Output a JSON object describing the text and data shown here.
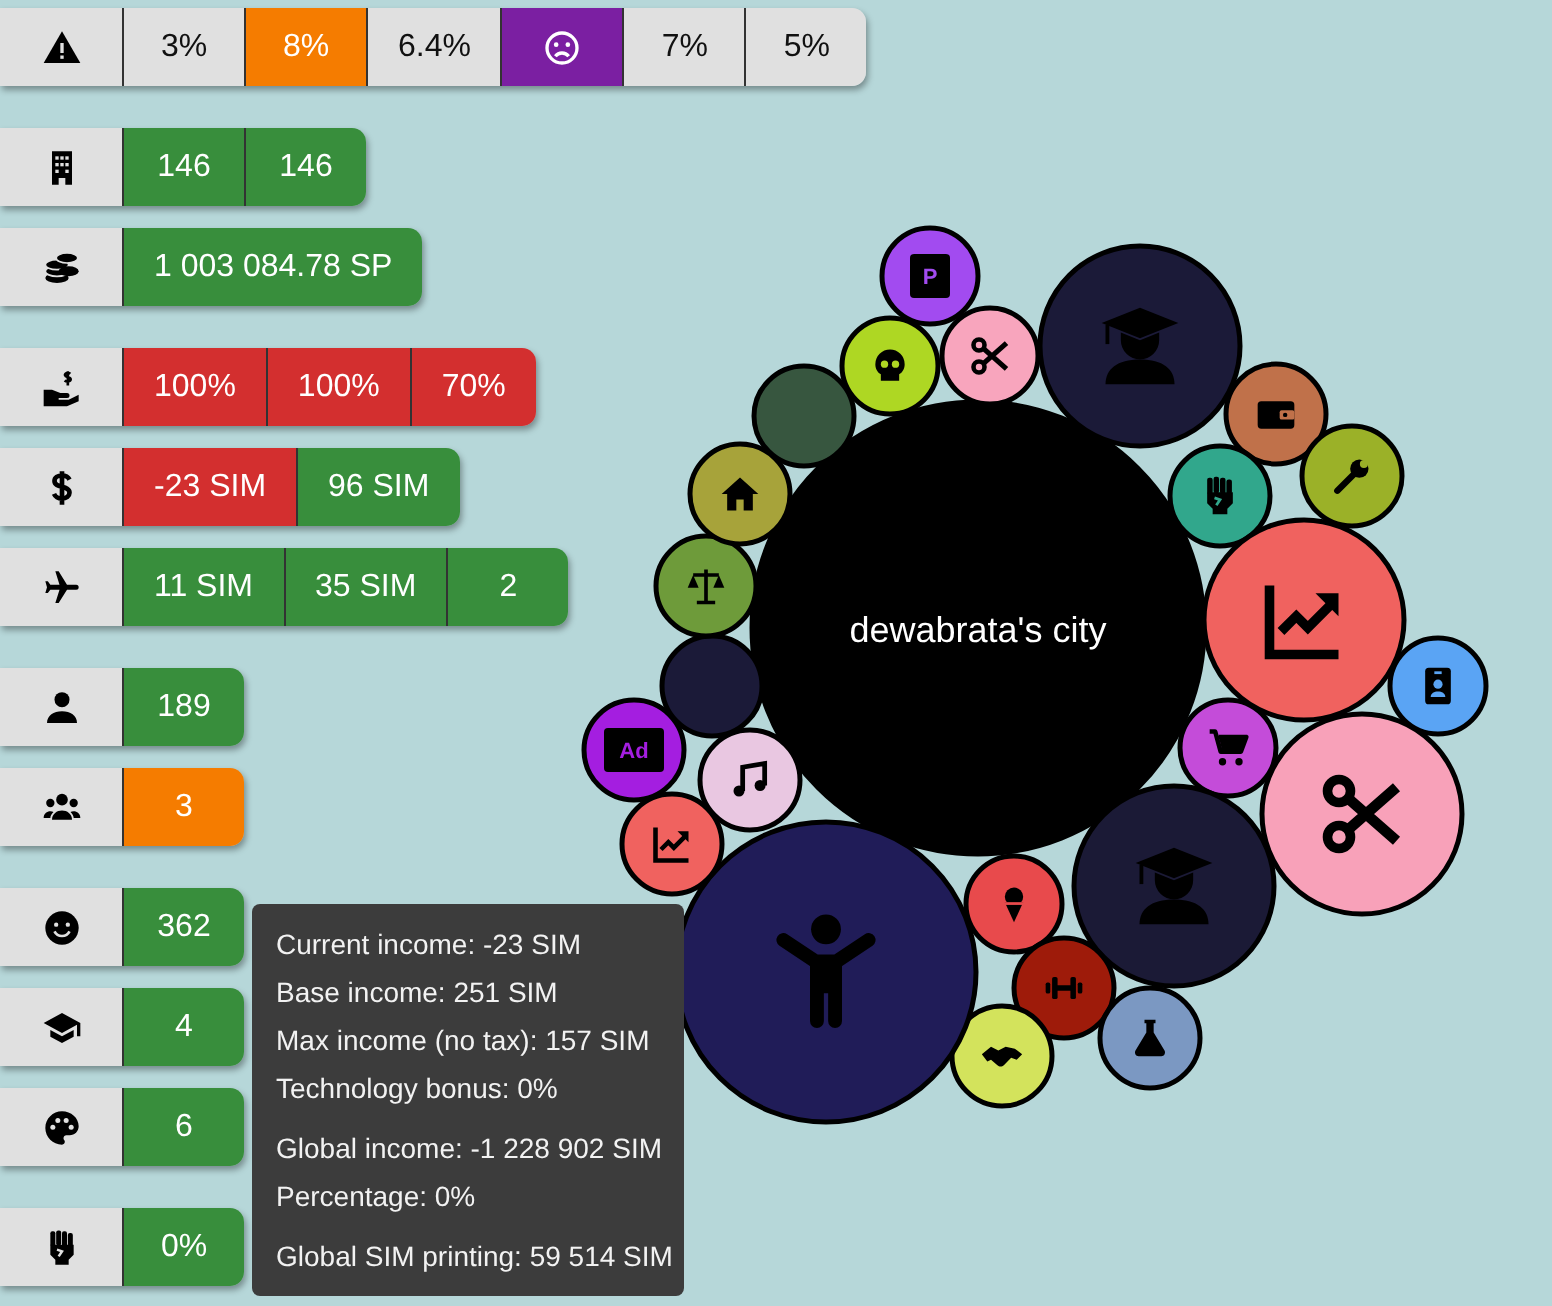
{
  "stat_groups": [
    {
      "rows": [
        {
          "cells": [
            {
              "kind": "text",
              "text": "3%",
              "color": "#e0e0e0"
            },
            {
              "kind": "text",
              "text": "8%",
              "color": "#f57c00"
            },
            {
              "kind": "text",
              "text": "6.4%",
              "color": "#e0e0e0"
            },
            {
              "kind": "icon",
              "color": "#7b1fa2"
            },
            {
              "kind": "text",
              "text": "7%",
              "color": "#e0e0e0"
            },
            {
              "kind": "text",
              "text": "5%",
              "color": "#e0e0e0"
            }
          ]
        }
      ]
    },
    {
      "rows": [
        {
          "cells": [
            {
              "kind": "text",
              "text": "146",
              "color": "#388e3c"
            },
            {
              "kind": "text",
              "text": "146",
              "color": "#388e3c"
            }
          ]
        },
        {
          "cells": [
            {
              "kind": "text",
              "text": "1 003 084.78 SP",
              "color": "#388e3c"
            }
          ]
        }
      ]
    },
    {
      "rows": [
        {
          "cells": [
            {
              "kind": "text",
              "text": "100%",
              "color": "#d32f2f"
            },
            {
              "kind": "text",
              "text": "100%",
              "color": "#d32f2f"
            },
            {
              "kind": "text",
              "text": "70%",
              "color": "#d32f2f"
            }
          ]
        },
        {
          "cells": [
            {
              "kind": "text",
              "text": "-23 SIM",
              "color": "#d32f2f"
            },
            {
              "kind": "text",
              "text": "96 SIM",
              "color": "#388e3c"
            }
          ]
        },
        {
          "cells": [
            {
              "kind": "text",
              "text": "11 SIM",
              "color": "#388e3c"
            },
            {
              "kind": "text",
              "text": "35 SIM",
              "color": "#388e3c"
            },
            {
              "kind": "text",
              "text": "2",
              "color": "#388e3c"
            }
          ]
        }
      ]
    },
    {
      "rows": [
        {
          "cells": [
            {
              "kind": "text",
              "text": "189",
              "color": "#388e3c"
            }
          ]
        },
        {
          "cells": [
            {
              "kind": "text",
              "text": "3",
              "color": "#f57c00"
            }
          ]
        }
      ]
    },
    {
      "rows": [
        {
          "cells": [
            {
              "kind": "text",
              "text": "362",
              "color": "#388e3c"
            }
          ]
        },
        {
          "cells": [
            {
              "kind": "text",
              "text": "4",
              "color": "#388e3c"
            }
          ]
        },
        {
          "cells": [
            {
              "kind": "text",
              "text": "6",
              "color": "#388e3c"
            }
          ]
        }
      ]
    },
    {
      "rows": [
        {
          "cells": [
            {
              "kind": "text",
              "text": "0%",
              "color": "#388e3c"
            }
          ]
        }
      ]
    }
  ],
  "bubbles": [
    {
      "kind": "city",
      "color": "#000000",
      "label": "dewabrata's city"
    },
    {
      "kind": "sign",
      "color": "#a24bf0",
      "label": "P"
    },
    {
      "kind": "icon",
      "color": "#aed723"
    },
    {
      "kind": "icon",
      "color": "#f8a5bd"
    },
    {
      "kind": "icon",
      "color": "#1b1a38"
    },
    {
      "kind": "icon",
      "color": "#c0714a"
    },
    {
      "kind": "icon",
      "color": "#9bb128"
    },
    {
      "kind": "icon",
      "color": "#31a78c"
    },
    {
      "kind": "icon",
      "color": "#f0625f"
    },
    {
      "kind": "icon",
      "color": "#5aa4f4"
    },
    {
      "kind": "icon",
      "color": "#c44cd9"
    },
    {
      "kind": "icon",
      "color": "#f8a1b9"
    },
    {
      "kind": "icon",
      "color": "#1b1a36"
    },
    {
      "kind": "icon",
      "color": "#e84a4c"
    },
    {
      "kind": "icon",
      "color": "#9e1b0a"
    },
    {
      "kind": "icon",
      "color": "#7b98c2"
    },
    {
      "kind": "icon",
      "color": "#d3e35c"
    },
    {
      "kind": "icon",
      "color": "#201c58"
    },
    {
      "kind": "icon",
      "color": "#f0625f"
    },
    {
      "kind": "icon",
      "color": "#e9c7e1"
    },
    {
      "kind": "sign",
      "color": "#a41ee0",
      "label": "Ad"
    },
    {
      "kind": "icon",
      "color": "#1b1a38"
    },
    {
      "kind": "icon",
      "color": "#6e9b3a"
    },
    {
      "kind": "icon",
      "color": "#a7a33a"
    },
    {
      "kind": "icon",
      "color": "#37563f"
    }
  ],
  "tooltip": {
    "sections": [
      [
        "Current income: -23 SIM",
        "Base income: 251 SIM",
        "Max income (no tax): 157 SIM",
        "Technology bonus: 0%"
      ],
      [
        "Global income: -1 228 902 SIM",
        "Percentage: 0%"
      ],
      [
        "Global SIM printing: 59 514 SIM"
      ]
    ]
  }
}
